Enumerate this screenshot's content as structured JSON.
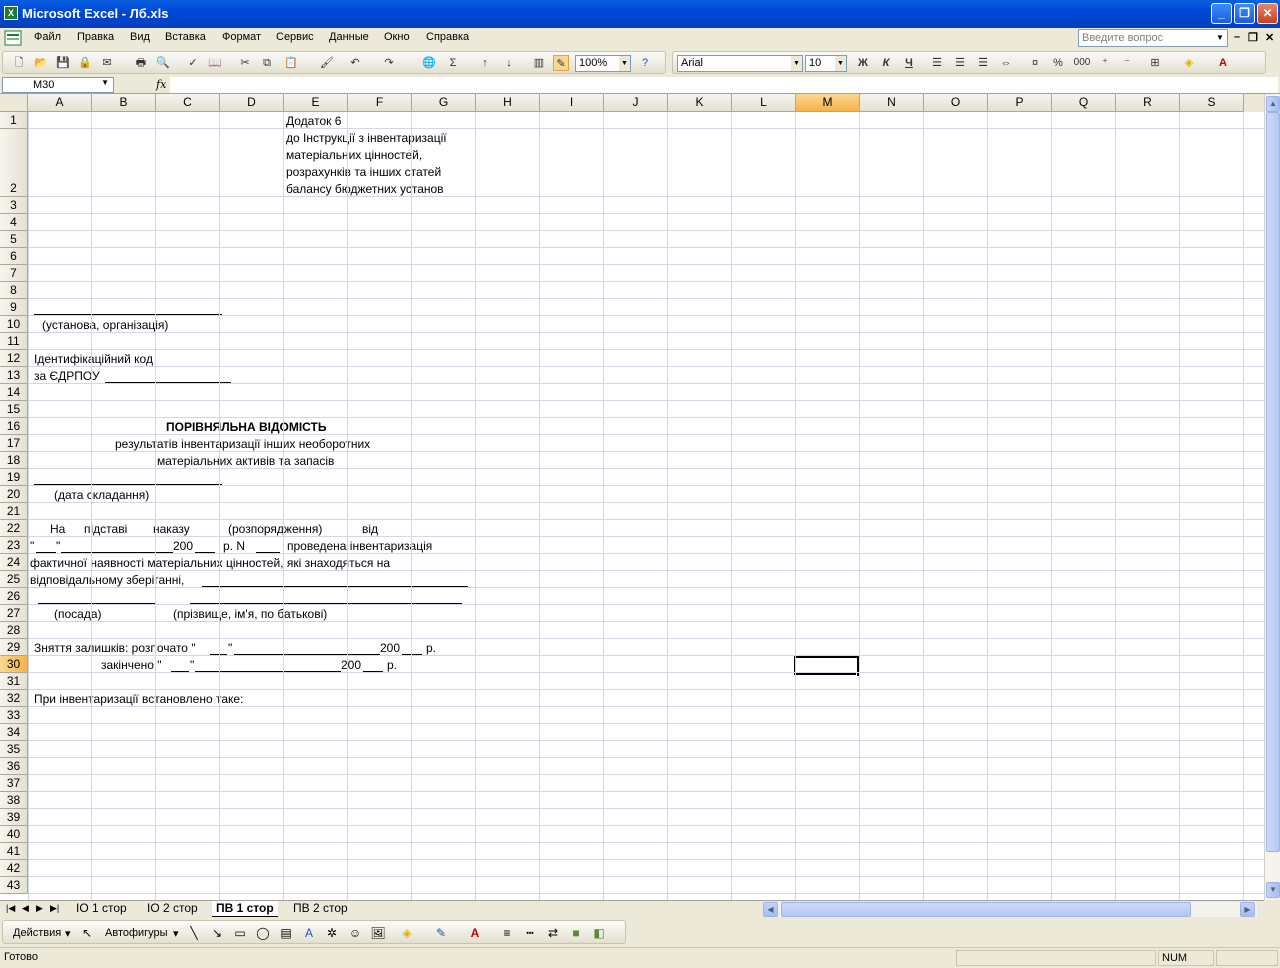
{
  "window": {
    "title": "Microsoft Excel - Лб.xls",
    "app_icon_glyph": "X"
  },
  "menubar": {
    "items": [
      "Файл",
      "Правка",
      "Вид",
      "Вставка",
      "Формат",
      "Сервис",
      "Данные",
      "Окно",
      "Справка"
    ],
    "help_placeholder": "Введите вопрос"
  },
  "toolbar": {
    "zoom": "100%",
    "font_name": "Arial",
    "font_size": "10",
    "bold_glyph": "Ж",
    "italic_glyph": "К",
    "underline_glyph": "Ч",
    "percent_glyph": "%",
    "thousands_glyph": "000",
    "sigma_glyph": "Σ"
  },
  "formula_bar": {
    "name_box": "M30",
    "fx": "fx",
    "formula": ""
  },
  "columns": [
    "A",
    "B",
    "C",
    "D",
    "E",
    "F",
    "G",
    "H",
    "I",
    "J",
    "K",
    "L",
    "M",
    "N",
    "O",
    "P",
    "Q",
    "R",
    "S"
  ],
  "selected_column": "M",
  "rows": [
    "1",
    "2",
    "3",
    "4",
    "5",
    "6",
    "7",
    "8",
    "9",
    "10",
    "11",
    "12",
    "13",
    "14",
    "15",
    "16",
    "17",
    "18",
    "19",
    "20",
    "21",
    "22",
    "23",
    "24",
    "25",
    "26",
    "27",
    "28",
    "29",
    "30",
    "31",
    "32",
    "33",
    "34",
    "35",
    "36",
    "37",
    "38",
    "39",
    "40",
    "41",
    "42",
    "43"
  ],
  "selected_row": "30",
  "cells": {
    "e1": "Додаток 6",
    "e2_line1": "до Інструкції з інвентаризації",
    "e2_line2": "матеріальних цінностей,",
    "e2_line3": "розрахунків та інших статей",
    "e2_line4": "балансу бюджетних установ",
    "a10": "(установа, організація)",
    "a12": "Ідентифікаційний код",
    "a13": "за ЄДРПОУ",
    "title16": "ПОРІВНЯЛЬНА ВІДОМІСТЬ",
    "title17": "результатів інвентаризації інших необоротних",
    "title18": "матеріальних активів та запасів",
    "a20": "(дата складання)",
    "a22_1": "На",
    "a22_2": "підставі",
    "a22_3": "наказу",
    "a22_4": "(розпорядження)",
    "a22_5": "від",
    "a23_1": "\"",
    "a23_2": "\"",
    "a23_3": "200",
    "a23_4": "р.  N",
    "a23_5": "проведена   інвентаризація",
    "a24": "фактичної  наявності  матеріальних  цінностей,  які знаходяться на",
    "a25": "відповідальному зберіганні,",
    "a27_1": "(посада)",
    "a27_2": "(прізвище, ім'я, по батькові)",
    "a29_1": "Зняття залишків: розпочато \"",
    "a29_2": "\"",
    "a29_3": "200",
    "a29_4": "р.",
    "a30_1": "закінчено \"",
    "a30_2": "\"",
    "a30_3": "200",
    "a30_4": "р.",
    "a32": "При інвентаризації встановлено таке:"
  },
  "sheet_tabs": [
    "ІО 1 стор",
    "ІО 2 стор",
    "ПВ 1 стор",
    "ПВ 2 стор"
  ],
  "active_tab": "ПВ 1 стор",
  "drawing_toolbar": {
    "actions": "Действия",
    "autoshapes": "Автофигуры"
  },
  "status": {
    "text": "Готово",
    "num": "NUM"
  },
  "colors": {
    "title_bar": "#0048d8",
    "selected_header": "#f4b24a",
    "grid_line": "#d0d7e5"
  }
}
